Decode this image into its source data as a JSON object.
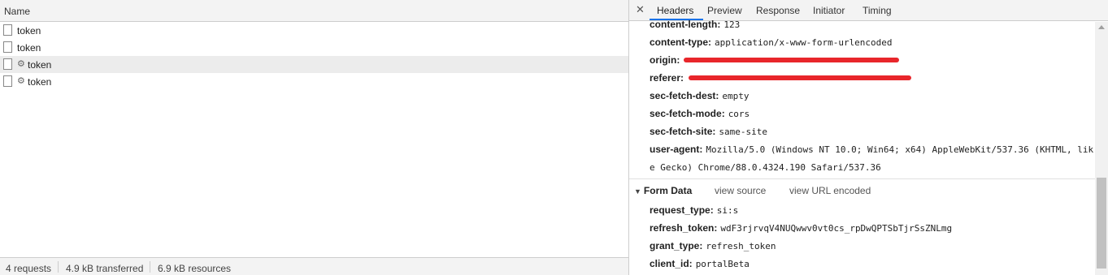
{
  "list": {
    "column_name": "Name",
    "requests": [
      {
        "name": "token",
        "preflight": false
      },
      {
        "name": "token",
        "preflight": false
      },
      {
        "name": "token",
        "preflight": true
      },
      {
        "name": "token",
        "preflight": true
      }
    ],
    "gear_glyph": "⚙"
  },
  "status": {
    "requests": "4 requests",
    "transferred": "4.9 kB transferred",
    "resources": "6.9 kB resources"
  },
  "details": {
    "close_glyph": "✕",
    "tabs": [
      "Headers",
      "Preview",
      "Response",
      "Initiator",
      "Timing"
    ],
    "active_tab": "Headers",
    "request_headers": [
      {
        "key": "content-length:",
        "value": "123"
      },
      {
        "key": "content-type:",
        "value": "application/x-www-form-urlencoded"
      },
      {
        "key": "origin:",
        "value": ""
      },
      {
        "key": "referer:",
        "value": ""
      },
      {
        "key": "sec-fetch-dest:",
        "value": "empty"
      },
      {
        "key": "sec-fetch-mode:",
        "value": "cors"
      },
      {
        "key": "sec-fetch-site:",
        "value": "same-site"
      },
      {
        "key": "user-agent:",
        "value": "Mozilla/5.0 (Windows NT 10.0; Win64; x64) AppleWebKit/537.36 (KHTML, lik",
        "value_cont": "e Gecko) Chrome/88.0.4324.190 Safari/537.36"
      }
    ],
    "form_data": {
      "title": "Form Data",
      "view_source": "view source",
      "view_url_encoded": "view URL encoded",
      "fields": [
        {
          "key": "request_type:",
          "value": "si:s"
        },
        {
          "key": "refresh_token:",
          "value": "wdF3rjrvqV4NUQwwv0vt0cs_rpDwQPTSbTjrSsZNLmg"
        },
        {
          "key": "grant_type:",
          "value": "refresh_token"
        },
        {
          "key": "client_id:",
          "value": "portalBeta"
        }
      ]
    }
  },
  "colors": {
    "accent": "#1a73e8",
    "redaction": "#e8262b"
  }
}
